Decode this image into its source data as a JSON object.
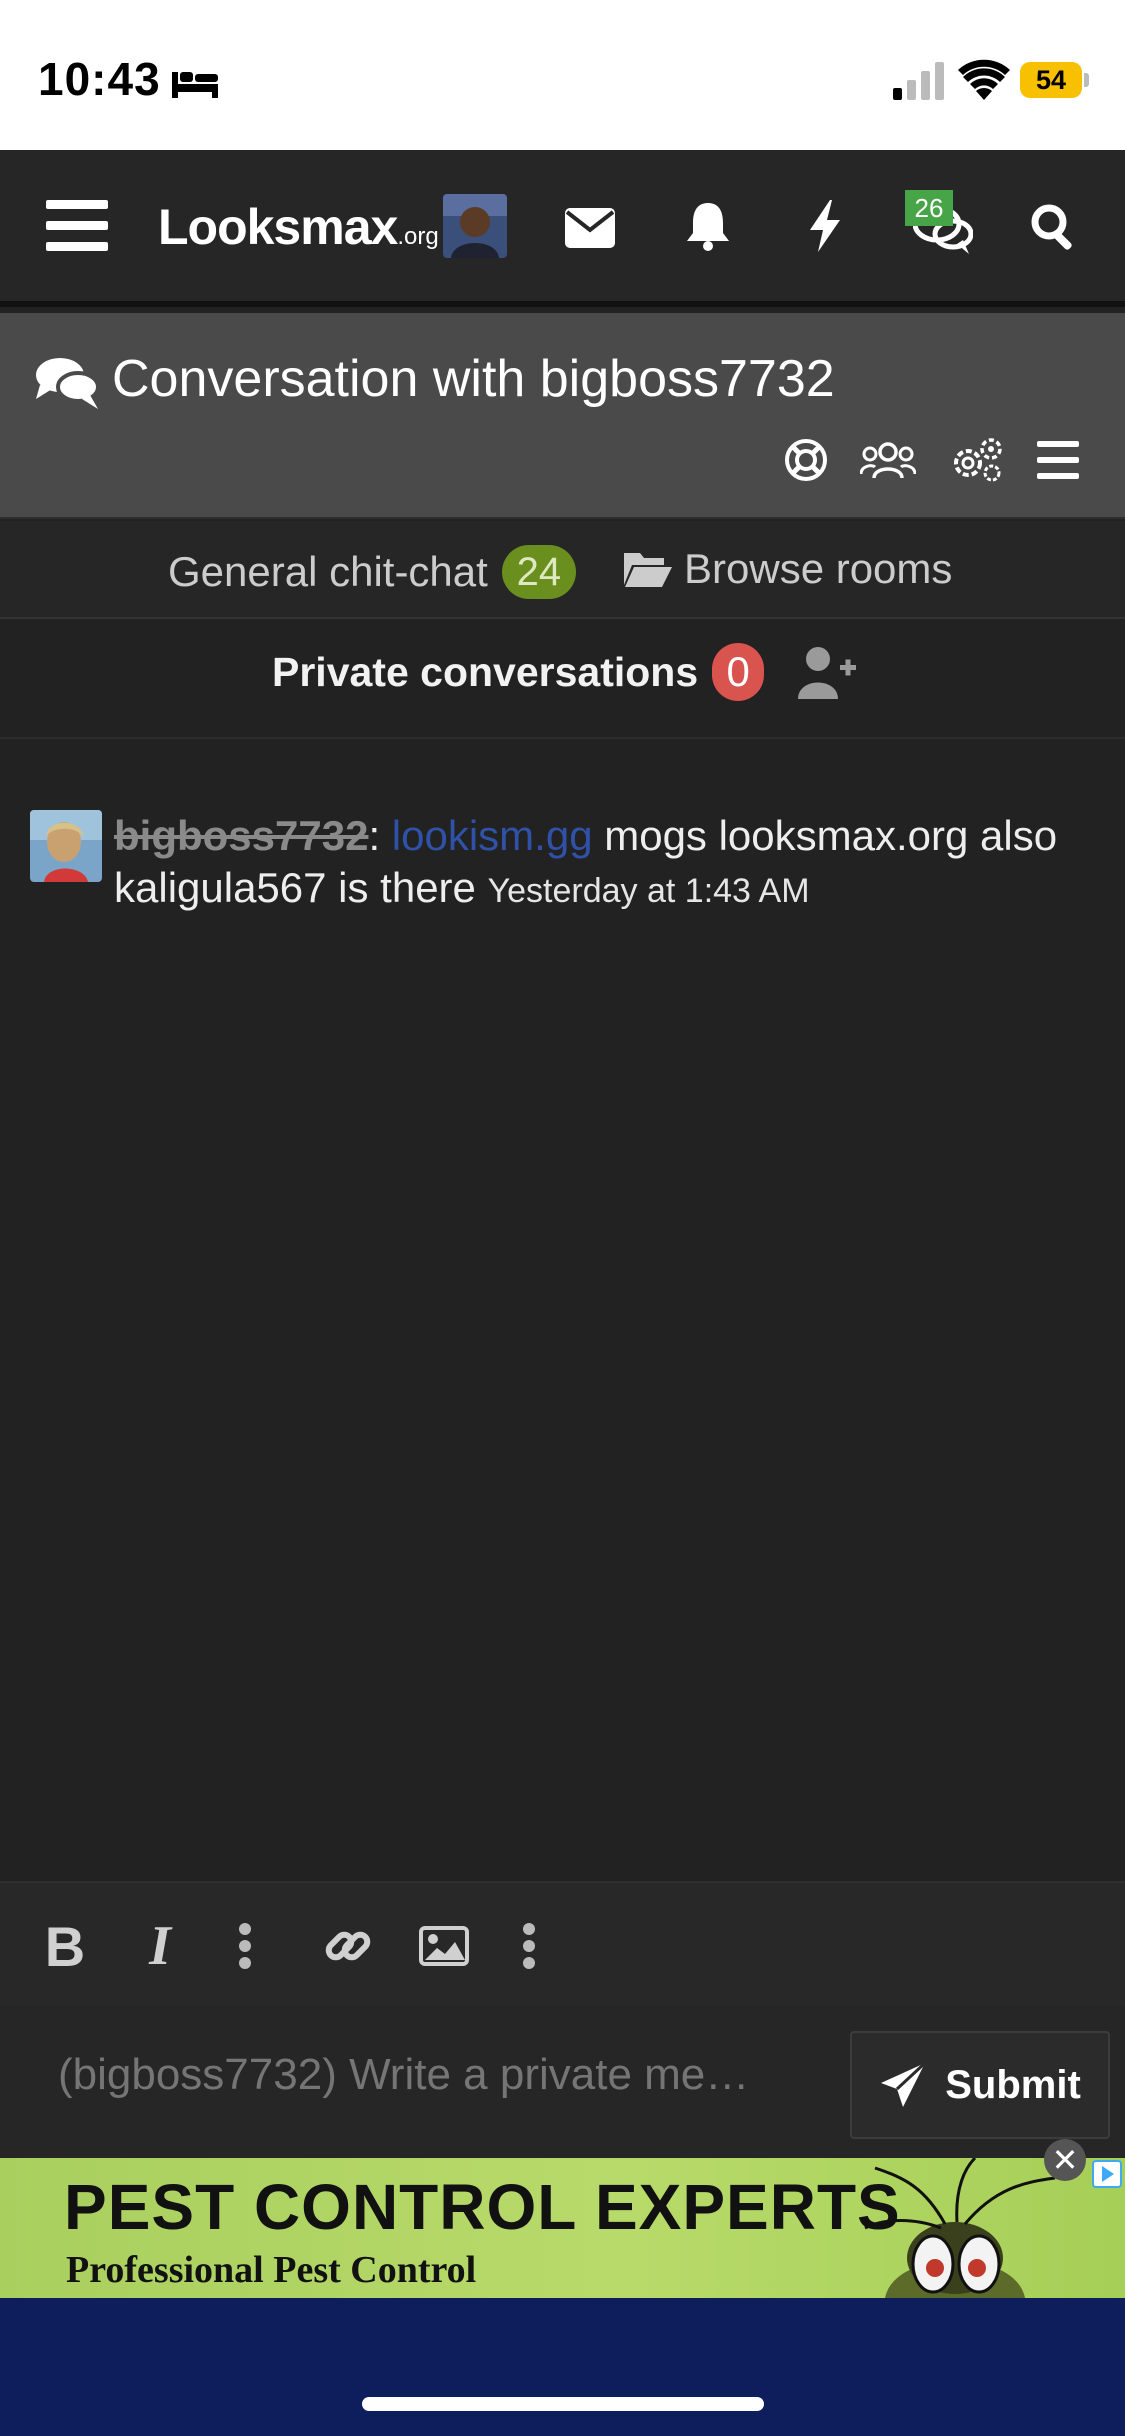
{
  "status_bar": {
    "time": "10:43",
    "battery": "54",
    "battery_color": "#f7c000"
  },
  "nav": {
    "logo_main": "Looksmax",
    "logo_suffix": ".org",
    "chat_count": "26",
    "icons": [
      "menu-icon",
      "mail-icon",
      "bell-icon",
      "bolt-icon",
      "chat-icon",
      "search-icon"
    ]
  },
  "conversation": {
    "title": "Conversation with bigboss7732"
  },
  "rooms": {
    "general_label": "General chit-chat",
    "general_count": "24",
    "browse_label": "Browse rooms"
  },
  "private": {
    "label": "Private conversations",
    "count": "0"
  },
  "message": {
    "author": "bigboss7732",
    "separator": ":",
    "link": "lookism.gg",
    "text": " mogs looksmax.org also kaligula567 is there",
    "time": "Yesterday at 1:43 AM"
  },
  "composer": {
    "placeholder": "(bigboss7732) Write a private me…",
    "submit_label": "Submit"
  },
  "ad": {
    "title": "PEST CONTROL EXPERTS",
    "subtitle": "Professional Pest Control",
    "close": "✕"
  },
  "colors": {
    "accent_green": "#47a547",
    "badge_green": "#6a8f1f",
    "badge_red": "#d9534f",
    "link_blue": "#2f52a8"
  }
}
